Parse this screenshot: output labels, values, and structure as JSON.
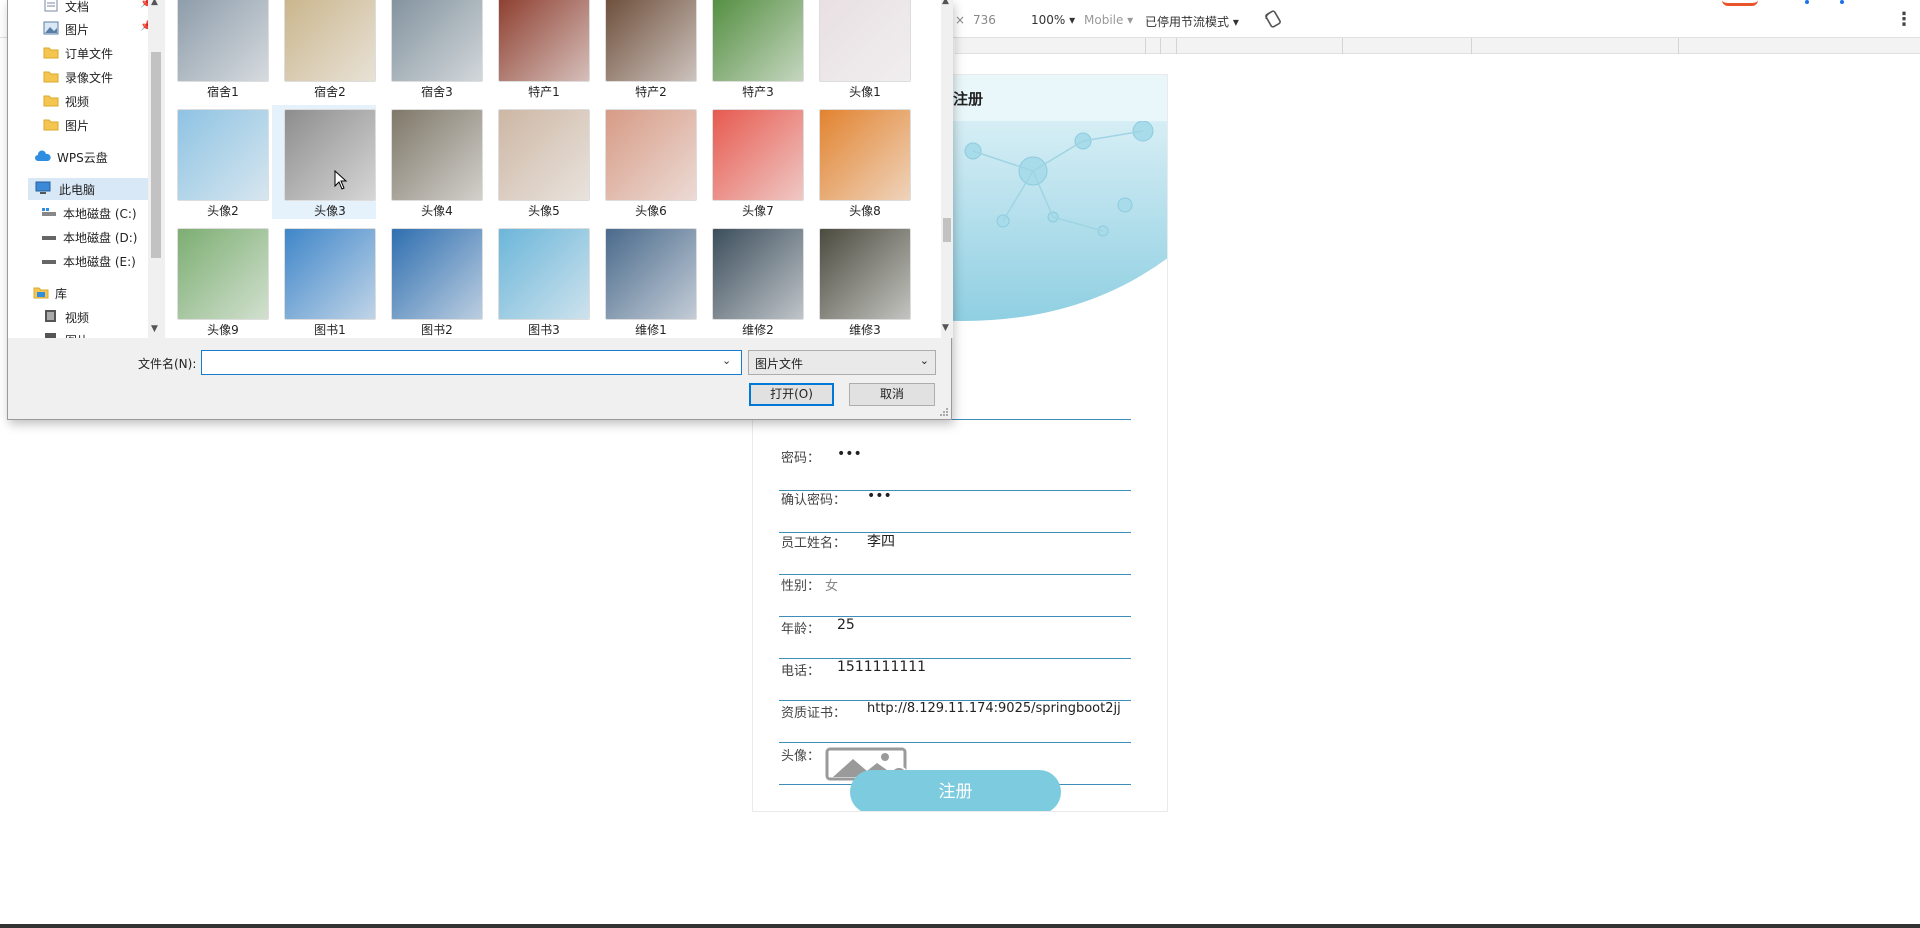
{
  "devtools": {
    "x_sep": "×",
    "height_value": "736",
    "zoom": "100% ▾",
    "device_mode": "Mobile ▾",
    "throttle": "已停用节流模式 ▾",
    "more": "⋮"
  },
  "registration": {
    "title": "注册",
    "fields": [
      {
        "label": "密码：",
        "value": "•••"
      },
      {
        "label": "确认密码：",
        "value": "•••"
      },
      {
        "label": "员工姓名：",
        "value": "李四"
      },
      {
        "label": "性别：",
        "value": "女"
      },
      {
        "label": "年龄：",
        "value": "25"
      },
      {
        "label": "电话：",
        "value": "1511111111"
      },
      {
        "label": "资质证书：",
        "value": "http://8.129.11.174:9025/springboot2jj"
      },
      {
        "label": "头像：",
        "value": ""
      }
    ],
    "submit": "注册",
    "avatar_icon": "image-upload-icon"
  },
  "dialog": {
    "nav": [
      {
        "label": "文档",
        "icon": "document-folder-icon"
      },
      {
        "label": "图片",
        "icon": "pictures-folder-icon"
      },
      {
        "label": "订单文件",
        "icon": "folder-icon"
      },
      {
        "label": "录像文件",
        "icon": "folder-icon"
      },
      {
        "label": "视频",
        "icon": "folder-icon"
      },
      {
        "label": "图片",
        "icon": "folder-icon"
      },
      {
        "label": "WPS云盘",
        "icon": "cloud-icon"
      },
      {
        "label": "此电脑",
        "icon": "computer-icon"
      },
      {
        "label": "本地磁盘 (C:)",
        "icon": "drive-icon"
      },
      {
        "label": "本地磁盘 (D:)",
        "icon": "drive-icon"
      },
      {
        "label": "本地磁盘 (E:)",
        "icon": "drive-icon"
      },
      {
        "label": "库",
        "icon": "library-icon"
      },
      {
        "label": "视频",
        "icon": "video-library-icon"
      },
      {
        "label": "图片",
        "icon": "picture-library-icon"
      }
    ],
    "files": [
      {
        "name": "宿舍1",
        "color": "#8a9aa8"
      },
      {
        "name": "宿舍2",
        "color": "#c9b48a"
      },
      {
        "name": "宿舍3",
        "color": "#7f909c"
      },
      {
        "name": "特产1",
        "color": "#8b3a2a"
      },
      {
        "name": "特产2",
        "color": "#6a4a36"
      },
      {
        "name": "特产3",
        "color": "#4f8c3c"
      },
      {
        "name": "头像1",
        "color": "#e8dfe2"
      },
      {
        "name": "头像2",
        "color": "#8ec3e3"
      },
      {
        "name": "头像3",
        "color": "#8d8d8d"
      },
      {
        "name": "头像4",
        "color": "#7f7869"
      },
      {
        "name": "头像5",
        "color": "#cdb7a4"
      },
      {
        "name": "头像6",
        "color": "#d79b86"
      },
      {
        "name": "头像7",
        "color": "#e65a4f"
      },
      {
        "name": "头像8",
        "color": "#e2832f"
      },
      {
        "name": "头像9",
        "color": "#7cae72"
      },
      {
        "name": "图书1",
        "color": "#3f86c9"
      },
      {
        "name": "图书2",
        "color": "#2f6fb0"
      },
      {
        "name": "图书3",
        "color": "#6cb6da"
      },
      {
        "name": "维修1",
        "color": "#4a6a8c"
      },
      {
        "name": "维修2",
        "color": "#3c4e5c"
      },
      {
        "name": "维修3",
        "color": "#4b4b3f"
      }
    ],
    "filename_label": "文件名(N):",
    "filename_value": "",
    "filetype": "图片文件",
    "open": "打开(O)",
    "cancel": "取消"
  },
  "colors": {
    "accent": "#7ccbdf",
    "underline": "#3d8fb8",
    "header": "#e9f7fb",
    "selection": "#e5f1fb"
  }
}
